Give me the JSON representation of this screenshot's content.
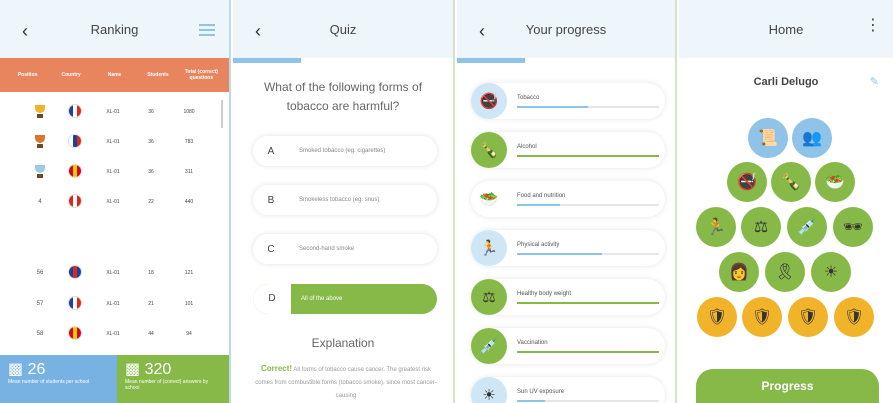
{
  "ranking": {
    "title": "Ranking",
    "headers": [
      "Position",
      "Country",
      "Name",
      "Students",
      "Total (correct) questions"
    ],
    "rows": [
      {
        "pos": "",
        "trophy": "#f0b32a",
        "flag": [
          "#1e3f9b",
          "#ffffff",
          "#d52b1e"
        ],
        "name": "XL-01",
        "students": "36",
        "total": "1080"
      },
      {
        "pos": "",
        "trophy": "#d9752d",
        "flag": [
          "#ffffff",
          "#1e3f9b",
          "#d52b1e"
        ],
        "name": "XL-01",
        "students": "36",
        "total": "783"
      },
      {
        "pos": "",
        "trophy": "#9ccbe8",
        "flag": [
          "#c60b1e",
          "#ffc400",
          "#c60b1e"
        ],
        "name": "XL-01",
        "students": "36",
        "total": "311"
      },
      {
        "pos": "4",
        "trophy": "",
        "flag": [
          "#d52b1e",
          "#ffffff",
          "#d52b1e"
        ],
        "name": "XL-01",
        "students": "22",
        "total": "440"
      },
      {
        "pos": "56",
        "trophy": "",
        "flag": [
          "#1e3f9b",
          "#d52b1e",
          "#1e3f9b"
        ],
        "name": "XL-01",
        "students": "18",
        "total": "121"
      },
      {
        "pos": "57",
        "trophy": "",
        "flag": [
          "#1e3f9b",
          "#ffffff",
          "#d52b1e"
        ],
        "name": "XL-01",
        "students": "21",
        "total": "101"
      },
      {
        "pos": "58",
        "trophy": "",
        "flag": [
          "#c60b1e",
          "#ffc400",
          "#c60b1e"
        ],
        "name": "XL-01",
        "students": "44",
        "total": "94"
      }
    ],
    "stat_students": {
      "value": "26",
      "caption": "Mean number of students per school"
    },
    "stat_correct": {
      "value": "320",
      "caption": "Mean number of (correct) answers by school"
    }
  },
  "quiz": {
    "title": "Quiz",
    "question": "What of the following forms of tobacco are harmful?",
    "options": [
      {
        "letter": "A",
        "text": "Smoked tobacco (eg. cigarettes)"
      },
      {
        "letter": "B",
        "text": "Smokeless tobacco (eg. snus)"
      },
      {
        "letter": "C",
        "text": "Second-hand smoke"
      },
      {
        "letter": "D",
        "text": "All of the above"
      }
    ],
    "selected_index": 3,
    "explanation_title": "Explanation",
    "explanation_correct": "Correct!",
    "explanation_text": "All forms of tobacco cause cancer. The greatest risk comes from combustible forms (tobacco smoke), since most cancer-causing"
  },
  "progress": {
    "title": "Your progress",
    "items": [
      {
        "label": "Tobacco",
        "progress": 0.5,
        "bar_color": "#8fc3e8",
        "icon_bg": "#cfe6f6",
        "icon": "🚭"
      },
      {
        "label": "Alcohol",
        "progress": 1.0,
        "bar_color": "#86b948",
        "icon_bg": "#86b948",
        "icon": "🍾"
      },
      {
        "label": "Food and nutrition",
        "progress": 0.3,
        "bar_color": "#8fc3e8",
        "icon_bg": "#ffffff",
        "icon": "🥗"
      },
      {
        "label": "Physical activity",
        "progress": 0.6,
        "bar_color": "#8fc3e8",
        "icon_bg": "#cfe6f6",
        "icon": "🏃"
      },
      {
        "label": "Healthy body weight",
        "progress": 1.0,
        "bar_color": "#86b948",
        "icon_bg": "#86b948",
        "icon": "⚖"
      },
      {
        "label": "Vaccination",
        "progress": 1.0,
        "bar_color": "#86b948",
        "icon_bg": "#86b948",
        "icon": "💉"
      },
      {
        "label": "Sun UV exposure",
        "progress": 0.2,
        "bar_color": "#8fc3e8",
        "icon_bg": "#cfe6f6",
        "icon": "☀"
      }
    ]
  },
  "home": {
    "title": "Home",
    "user_name": "Carli Delugo",
    "progress_button": "Progress",
    "badges": [
      {
        "name": "badge-diploma",
        "bg": "#8fc3e8",
        "icon": "📜"
      },
      {
        "name": "badge-people",
        "bg": "#8fc3e8",
        "icon": "👥"
      },
      {
        "name": "badge-no-smoking",
        "bg": "#86b948",
        "icon": "🚭"
      },
      {
        "name": "badge-alcohol",
        "bg": "#86b948",
        "icon": "🍾"
      },
      {
        "name": "badge-food",
        "bg": "#86b948",
        "icon": "🥗"
      },
      {
        "name": "badge-running",
        "bg": "#86b948",
        "icon": "🏃"
      },
      {
        "name": "badge-scale",
        "bg": "#86b948",
        "icon": "⚖"
      },
      {
        "name": "badge-vaccine",
        "bg": "#86b948",
        "icon": "💉"
      },
      {
        "name": "badge-sunglasses",
        "bg": "#86b948",
        "icon": "🕶"
      },
      {
        "name": "badge-doctor",
        "bg": "#86b948",
        "icon": "👩"
      },
      {
        "name": "badge-ribbon",
        "bg": "#86b948",
        "icon": "🎗"
      },
      {
        "name": "badge-sun",
        "bg": "#86b948",
        "icon": "☀"
      },
      {
        "name": "badge-medal-1",
        "bg": "#f0b32a",
        "icon": "🛡"
      },
      {
        "name": "badge-medal-2",
        "bg": "#f0b32a",
        "icon": "🛡"
      },
      {
        "name": "badge-medal-3",
        "bg": "#f0b32a",
        "icon": "🛡"
      },
      {
        "name": "badge-medal-4",
        "bg": "#f0b32a",
        "icon": "🛡"
      }
    ]
  }
}
